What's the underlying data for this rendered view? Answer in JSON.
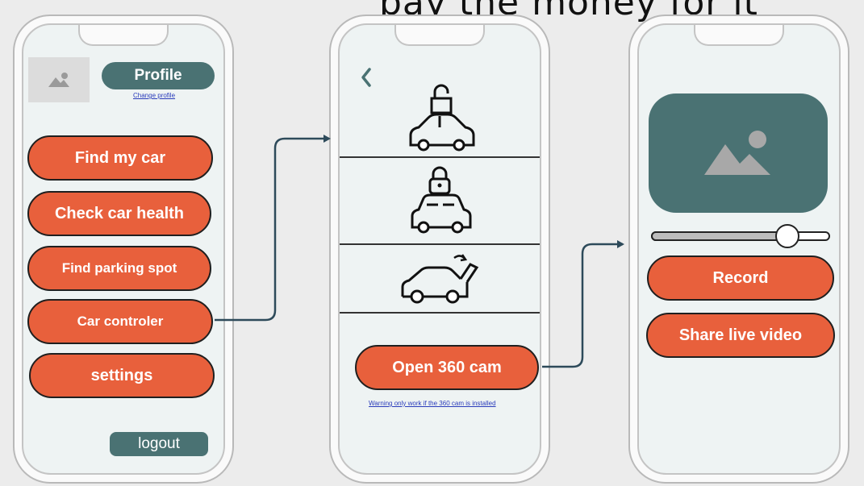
{
  "overlay_caption": "pay the money  for it",
  "colors": {
    "accent": "#e8603c",
    "teal": "#4a7273",
    "screen": "#eef3f3",
    "arrow": "#2d4a5a"
  },
  "screen1": {
    "avatar_icon": "image-placeholder-icon",
    "profile_label": "Profile",
    "change_profile_link": "Change profile",
    "menu": [
      {
        "label": "Find my car"
      },
      {
        "label": "Check car health"
      },
      {
        "label": "Find parking spot"
      },
      {
        "label": "Car controler"
      },
      {
        "label": "settings"
      }
    ],
    "logout_label": "logout"
  },
  "screen2": {
    "back_icon": "chevron-left-icon",
    "controls": [
      {
        "icon": "car-unlock-icon"
      },
      {
        "icon": "car-lock-icon"
      },
      {
        "icon": "car-trunk-open-icon"
      }
    ],
    "open_cam_label": "Open 360 cam",
    "warning_link": "Warning only work if the 360 cam is installed"
  },
  "screen3": {
    "video_icon": "image-placeholder-icon",
    "slider_value": 0.8,
    "record_label": "Record",
    "share_label": "Share live video"
  }
}
